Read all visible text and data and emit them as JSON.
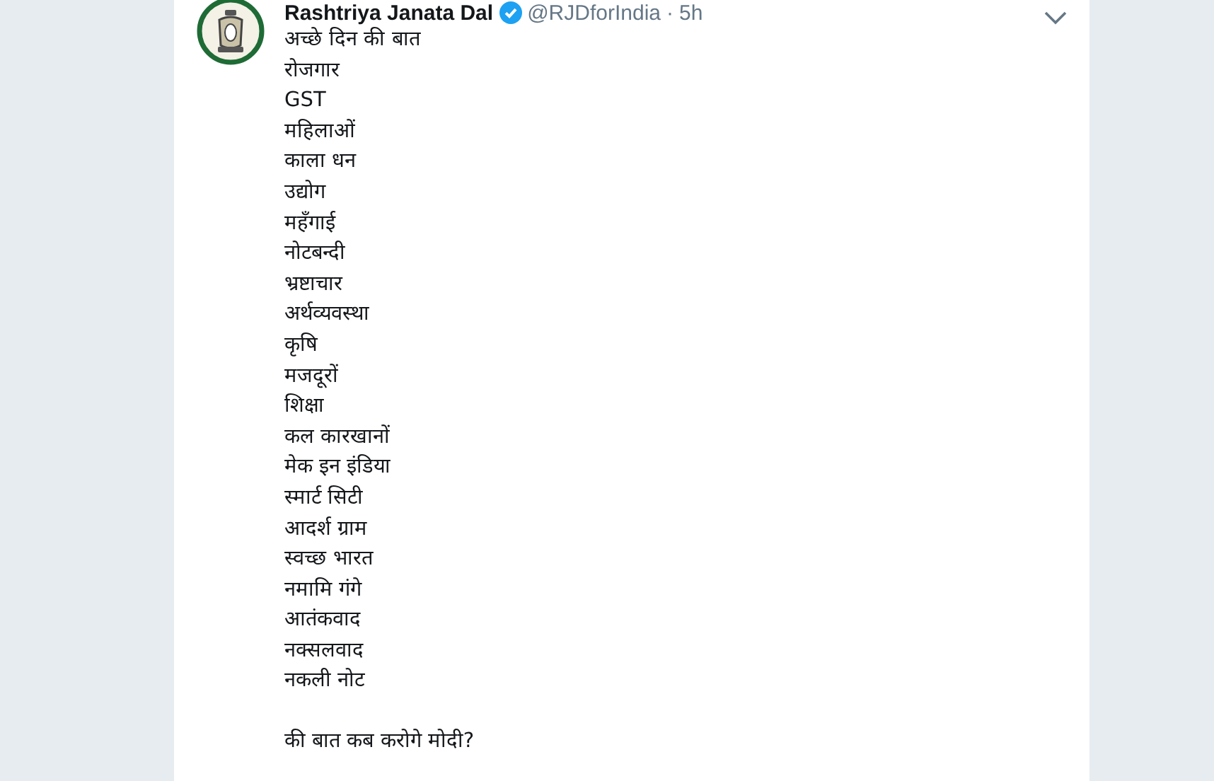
{
  "tweet": {
    "author": "Rashtriya Janata Dal",
    "verified": true,
    "handle": "@RJDforIndia",
    "separator": "·",
    "time": "5h",
    "lines": [
      "अच्छे दिन की बात",
      "रोजगार",
      "GST",
      "महिलाओं",
      "काला धन",
      "उद्योग",
      "महँगाई",
      "नोटबन्दी",
      "भ्रष्टाचार",
      "अर्थव्यवस्था",
      "कृषि",
      "मजदूरों",
      "शिक्षा",
      "कल कारखानों",
      "मेक इन इंडिया",
      "स्मार्ट सिटी",
      "आदर्श ग्राम",
      "स्वच्छ भारत",
      "नमामि गंगे",
      "आतंकवाद",
      "नक्सलवाद",
      "नकली नोट"
    ],
    "closing": "की बात कब करोगे मोदी?"
  }
}
